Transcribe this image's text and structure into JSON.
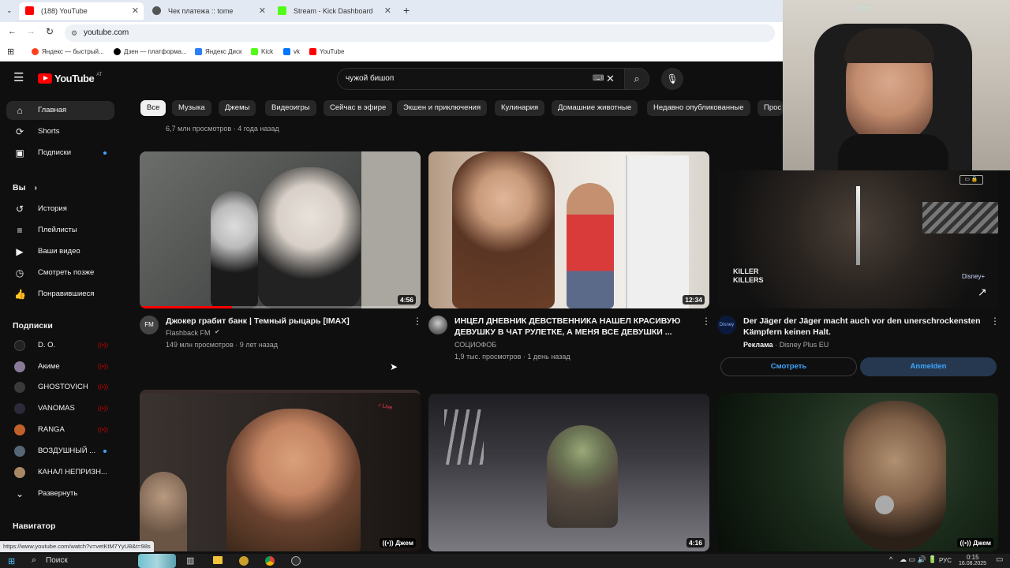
{
  "browser": {
    "tabs": [
      {
        "label": "(188) YouTube",
        "fav_color": "#ff0000"
      },
      {
        "label": "Чек платежа :: tome",
        "fav_color": "#555555"
      },
      {
        "label": "Stream - Kick Dashboard",
        "fav_color": "#53fc18"
      }
    ],
    "new_tab": "+",
    "url": "youtube.com",
    "bookmarks": [
      {
        "label": "Яндекс — быстрый...",
        "color": "#fc3f1d"
      },
      {
        "label": "Дзен — платформа...",
        "color": "#000000"
      },
      {
        "label": "Яндекс Диск",
        "color": "#2c7ef8"
      },
      {
        "label": "Kick",
        "color": "#53fc18"
      },
      {
        "label": "vk",
        "color": "#0077ff"
      },
      {
        "label": "YouTube",
        "color": "#ff0000"
      }
    ],
    "status_url": "https://www.youtube.com/watch?v=vetKtM7YyU8&t=98s"
  },
  "youtube": {
    "logo": "YouTube",
    "logo_region": "AT",
    "search_value": "чужой бишоп",
    "chips": [
      "Все",
      "Музыка",
      "Джемы",
      "Видеоигры",
      "Сейчас в эфире",
      "Экшен и приключения",
      "Кулинария",
      "Домашние животные",
      "Недавно опубликованные",
      "Прос"
    ],
    "sidebar": {
      "main": [
        {
          "label": "Главная",
          "icon": "home-icon"
        },
        {
          "label": "Shorts",
          "icon": "shorts-icon"
        },
        {
          "label": "Подписки",
          "icon": "subscriptions-icon"
        }
      ],
      "you_header": "Вы",
      "you": [
        {
          "label": "История",
          "icon": "history-icon"
        },
        {
          "label": "Плейлисты",
          "icon": "playlists-icon"
        },
        {
          "label": "Ваши видео",
          "icon": "your-videos-icon"
        },
        {
          "label": "Смотреть позже",
          "icon": "watch-later-icon"
        },
        {
          "label": "Понравившиеся",
          "icon": "liked-icon"
        }
      ],
      "subs_header": "Подписки",
      "subs": [
        {
          "label": "D. O.",
          "color": "#222222"
        },
        {
          "label": "Акиме",
          "color": "#8a7a9a"
        },
        {
          "label": "GHOSTOVICH",
          "color": "#3a3a3a"
        },
        {
          "label": "VANOMAS",
          "color": "#2a2a3a"
        },
        {
          "label": "RANGA",
          "color": "#c0602a"
        },
        {
          "label": "ВОЗДУШНЫЙ ...",
          "color": "#556677"
        },
        {
          "label": "КАНАЛ НЕПРИЗН...",
          "color": "#aa8866"
        }
      ],
      "expand": "Развернуть",
      "navigator": "Навигатор"
    },
    "top_meta": "6,7 млн просмотров · 4 года назад",
    "videos": [
      {
        "title": "Джокер грабит банк | Темный рыцарь [IMAX]",
        "channel": "Flashback FM",
        "views": "149 млн просмотров · 9 лет назад",
        "duration": "4:56",
        "progress": 0.33
      },
      {
        "title_l1": "ИНЦЕЛ ДНЕВНИК ДЕВСТВЕННИКА НАШЕЛ КРАСИВУЮ",
        "title_l2": "ДЕВУШКУ В ЧАТ РУЛЕТКЕ, А МЕНЯ ВСЕ ДЕВУШКИ ...",
        "channel": "СОЦИОФОБ",
        "views": "1,9 тыс. просмотров · 1 день назад",
        "duration": "12:34"
      },
      {
        "title_l1": "Der Jäger der Jäger macht auch vor den unerschrockensten",
        "title_l2": "Kämpfern keinen Halt.",
        "ad_label": "Реклама",
        "channel": "Disney Plus EU",
        "btn_watch": "Смотреть",
        "btn_signup": "Anmelden",
        "thumb_text_1": "KILLER",
        "thumb_text_2": "KILLERS"
      }
    ],
    "row2": [
      {
        "badge": "Джем"
      },
      {
        "duration": "4:16"
      },
      {
        "badge": "Джем"
      }
    ]
  },
  "taskbar": {
    "search": "Поиск",
    "lang": "РУС",
    "time": "0:15",
    "date": "16.08.2025"
  }
}
